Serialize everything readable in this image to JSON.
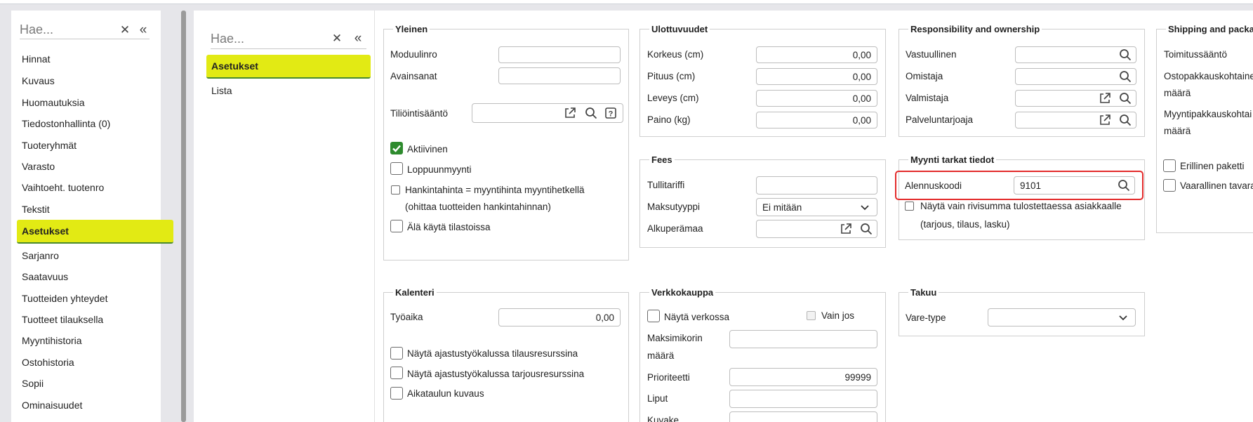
{
  "colors": {
    "active_highlight": "#e2ea14",
    "checkbox_checked": "#2e8b2e",
    "focus_outline": "#e32a2a"
  },
  "left_nav": {
    "search_placeholder": "Hae...",
    "items": [
      "Hinnat",
      "Kuvaus",
      "Huomautuksia",
      "Tiedostonhallinta (0)",
      "Tuoteryhmät",
      "Varasto",
      "Vaihtoeht. tuotenro",
      "Tekstit",
      "Asetukset",
      "Sarjanro",
      "Saatavuus",
      "Tuotteiden yhteydet",
      "Tuotteet tilauksella",
      "Myyntihistoria",
      "Ostohistoria",
      "Sopii",
      "Ominaisuudet"
    ],
    "active_index": 8
  },
  "sub_nav": {
    "search_placeholder": "Hae...",
    "items": [
      "Asetukset",
      "Lista"
    ],
    "active_index": 0
  },
  "yleinen": {
    "title": "Yleinen",
    "moduulinro_label": "Moduulinro",
    "moduulinro_value": "",
    "avainsanat_label": "Avainsanat",
    "avainsanat_value": "",
    "tiliointisaanto_label": "Tiliöintisääntö",
    "aktiivinen_label": "Aktiivinen",
    "loppuunmyynti_label": "Loppuunmyynti",
    "hankintahinta_line1": "Hankintahinta = myyntihinta myyntihetkellä",
    "hankintahinta_line2": "(ohittaa tuotteiden hankintahinnan)",
    "ala_kayta_label": "Älä käytä tilastoissa"
  },
  "ulottuvuudet": {
    "title": "Ulottuvuudet",
    "korkeus_label": "Korkeus (cm)",
    "korkeus_value": "0,00",
    "pituus_label": "Pituus (cm)",
    "pituus_value": "0,00",
    "leveys_label": "Leveys (cm)",
    "leveys_value": "0,00",
    "paino_label": "Paino (kg)",
    "paino_value": "0,00"
  },
  "responsibility": {
    "title": "Responsibility and ownership",
    "vastuullinen_label": "Vastuullinen",
    "omistaja_label": "Omistaja",
    "valmistaja_label": "Valmistaja",
    "palveluntarjoaja_label": "Palveluntarjoaja"
  },
  "shipping": {
    "title": "Shipping and packa",
    "toimitussaanto_label": "Toimitussääntö",
    "ostopakkaus_line1": "Ostopakkauskohtaine",
    "ostopakkaus_line2": "määrä",
    "myyntipakkaus_line1": "Myyntipakkauskohtai",
    "myyntipakkaus_line2": "määrä",
    "erillinen_label": "Erillinen paketti",
    "vaarallinen_label": "Vaarallinen tavara"
  },
  "fees": {
    "title": "Fees",
    "tullitariffi_label": "Tullitariffi",
    "tullitariffi_value": "",
    "maksutyyppi_label": "Maksutyyppi",
    "maksutyyppi_value": "Ei mitään",
    "alkuperamaa_label": "Alkuperämaa"
  },
  "myynti": {
    "title": "Myynti tarkat tiedot",
    "alennuskoodi_label": "Alennuskoodi",
    "alennuskoodi_value": "9101",
    "rivisumma_line1": "Näytä vain rivisumma tulostettaessa asiakkaalle",
    "rivisumma_line2": "(tarjous, tilaus, lasku)"
  },
  "kalenteri": {
    "title": "Kalenteri",
    "tyoaika_label": "Työaika",
    "tyoaika_value": "0,00",
    "tilausresurssina_label": "Näytä ajastustyökalussa tilausresurssina",
    "tarjousresurssina_label": "Näytä ajastustyökalussa tarjousresurssina",
    "aikataulun_label": "Aikataulun kuvaus"
  },
  "verkkokauppa": {
    "title": "Verkkokauppa",
    "nayta_verkossa_label": "Näytä verkossa",
    "vain_jos_label": "Vain jos",
    "maksimikorin_line1": "Maksimikorin",
    "maksimikorin_line2": "määrä",
    "prioriteetti_label": "Prioriteetti",
    "prioriteetti_value": "99999",
    "liput_label": "Liput",
    "kuvake_label": "Kuvake"
  },
  "takuu": {
    "title": "Takuu",
    "vare_type_label": "Vare-type",
    "vare_type_value": ""
  }
}
